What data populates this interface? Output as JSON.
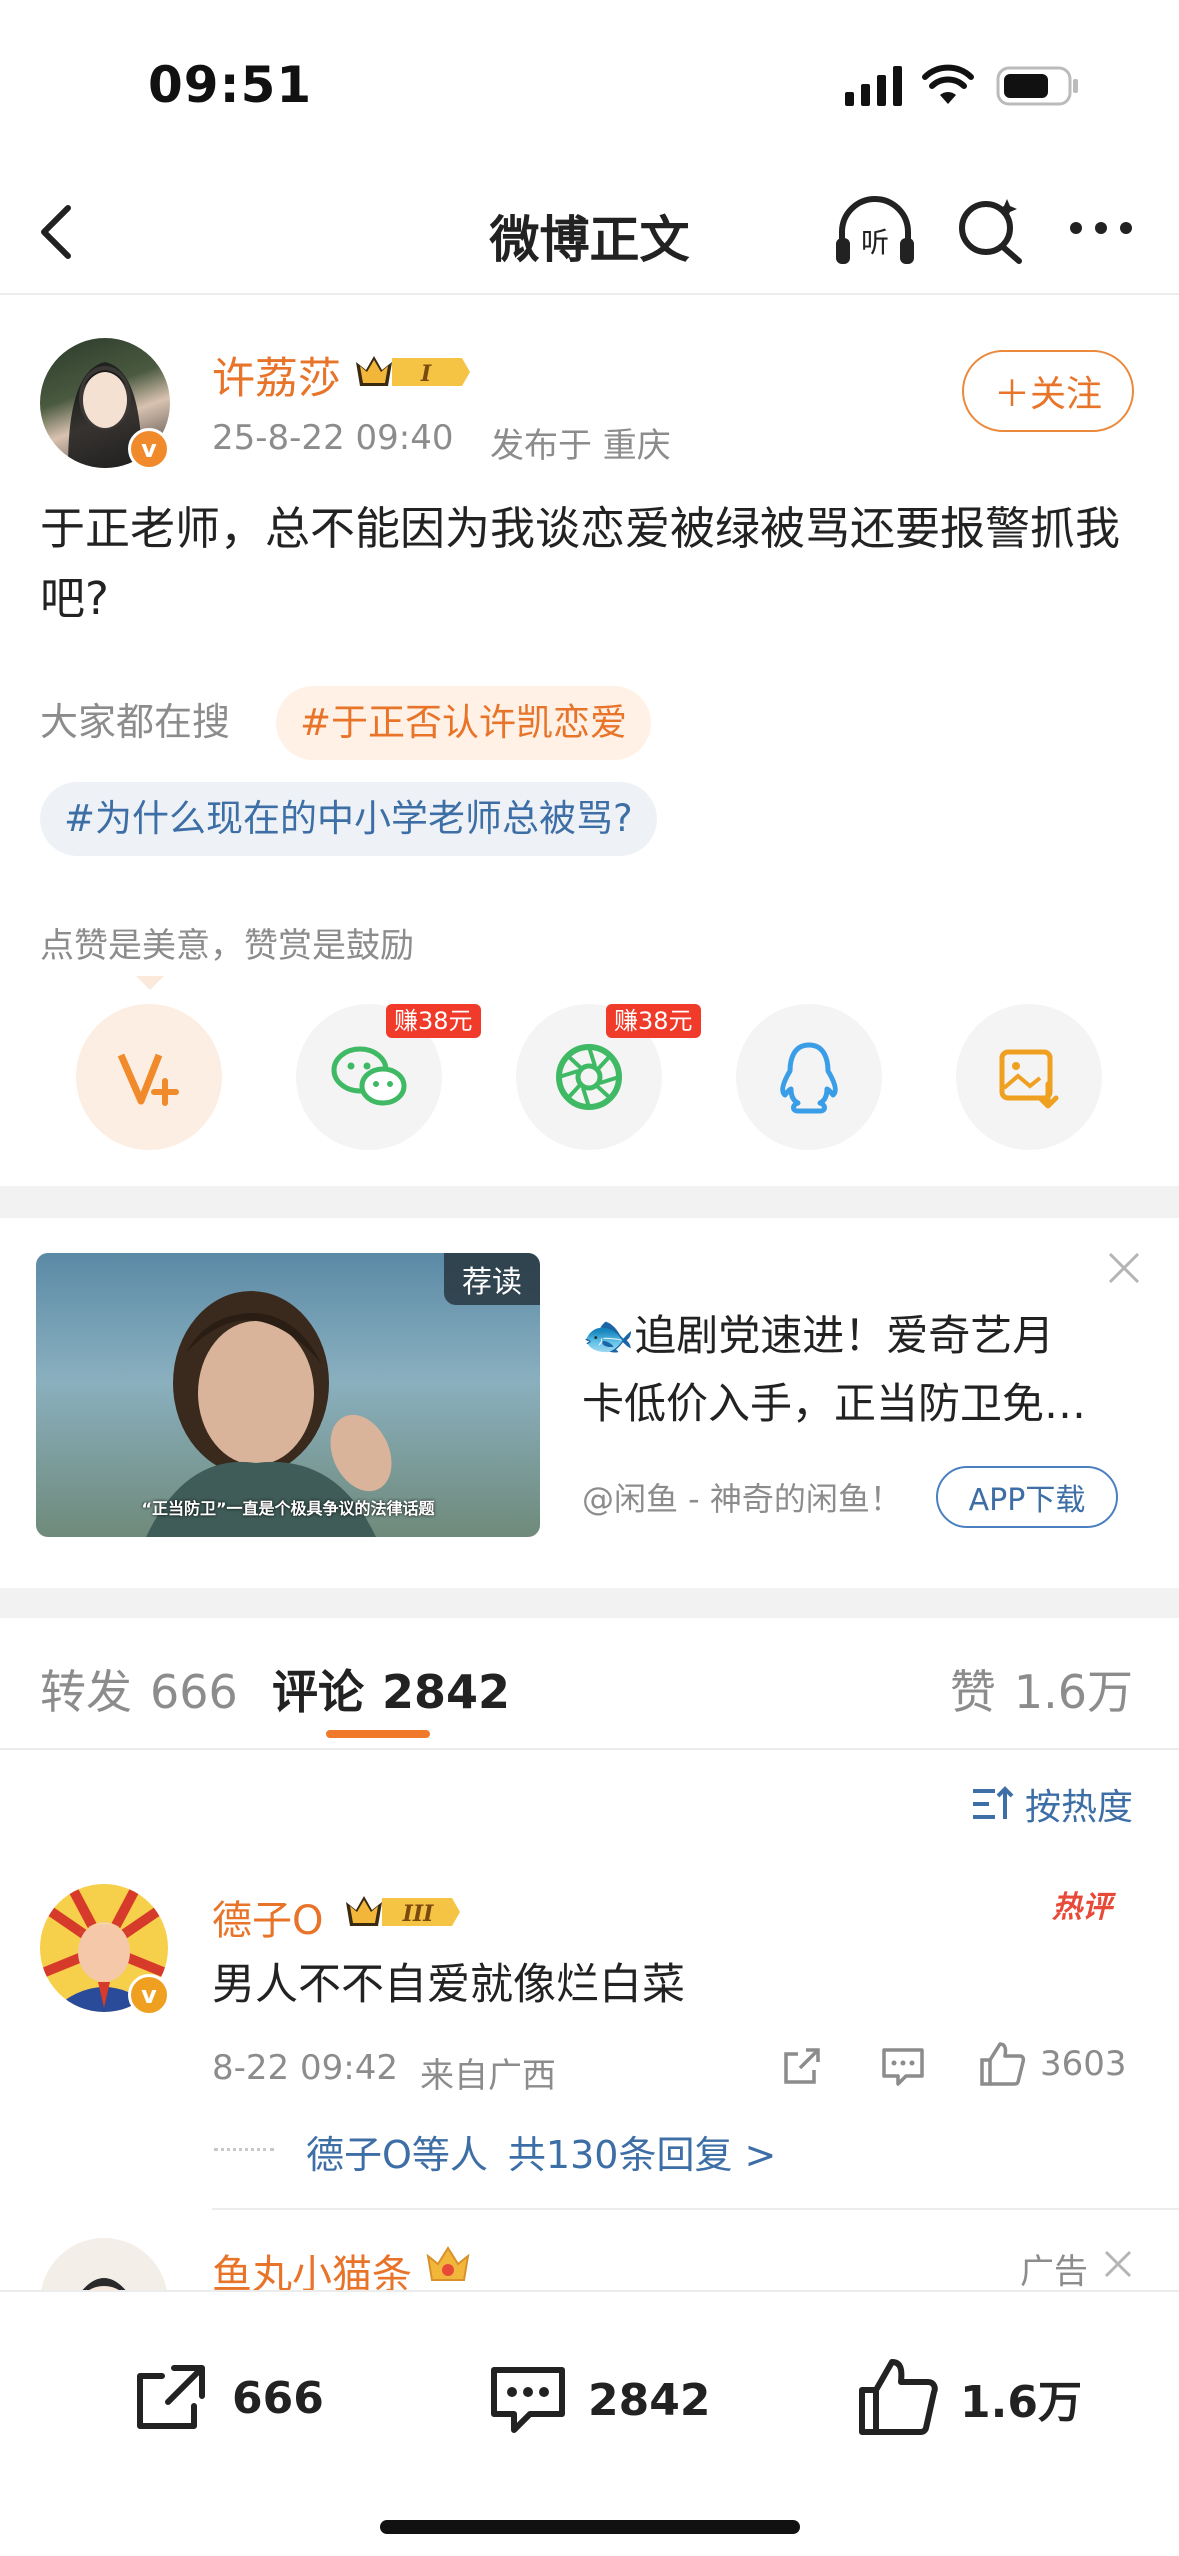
{
  "status_bar": {
    "time": "09:51"
  },
  "nav": {
    "title": "微博正文"
  },
  "post": {
    "author": "许荔莎",
    "level_badge": "I",
    "verified_mark": "v",
    "meta_time": "25-8-22 09:40",
    "meta_location": "发布于 重庆",
    "follow_label": "＋关注",
    "text": "于正老师，总不能因为我谈恋爱被绿被骂还要报警抓我吧?",
    "search_label": "大家都在搜",
    "hashtags": [
      "#于正否认许凯恋爱",
      "#为什么现在的中小学老师总被骂?"
    ],
    "reward_text": "点赞是美意，赞赏是鼓励"
  },
  "share": {
    "earn1": "赚38元",
    "earn2": "赚38元",
    "icons": [
      "reward-v-icon",
      "wechat-icon",
      "moments-icon",
      "qq-icon",
      "save-image-icon"
    ]
  },
  "ad": {
    "badge": "荐读",
    "caption": "“正当防卫”一直是个极具争议的法律话题",
    "title": "🐟追剧党速进！爱奇艺月卡低价入手，正当防卫免…",
    "title_line1": "🐟追剧党速进！爱奇艺月",
    "title_line2": "卡低价入手，正当防卫免…",
    "source": "@闲鱼 - 神奇的闲鱼！",
    "download": "APP下载"
  },
  "tabs": {
    "repost_label": "转发",
    "repost_count": "666",
    "comment_label": "评论",
    "comment_count": "2842",
    "like_label": "赞",
    "like_count": "1.6万",
    "sort_label": "按热度"
  },
  "comments": [
    {
      "author": "德子O",
      "level_badge": "III",
      "hot_label": "热评",
      "text": "男人不不自爱就像烂白菜",
      "time": "8-22 09:42",
      "location": "来自广西",
      "likes": "3603",
      "replies": "德子O等人",
      "replies_count": "共130条回复 >"
    },
    {
      "author": "鱼丸小猫条",
      "ad_label": "广告"
    }
  ],
  "bottom_bar": {
    "repost": "666",
    "comment": "2842",
    "like": "1.6万"
  },
  "colors": {
    "accent": "#e8742a",
    "link": "#3d6fa6",
    "hot": "#e84a3a"
  }
}
